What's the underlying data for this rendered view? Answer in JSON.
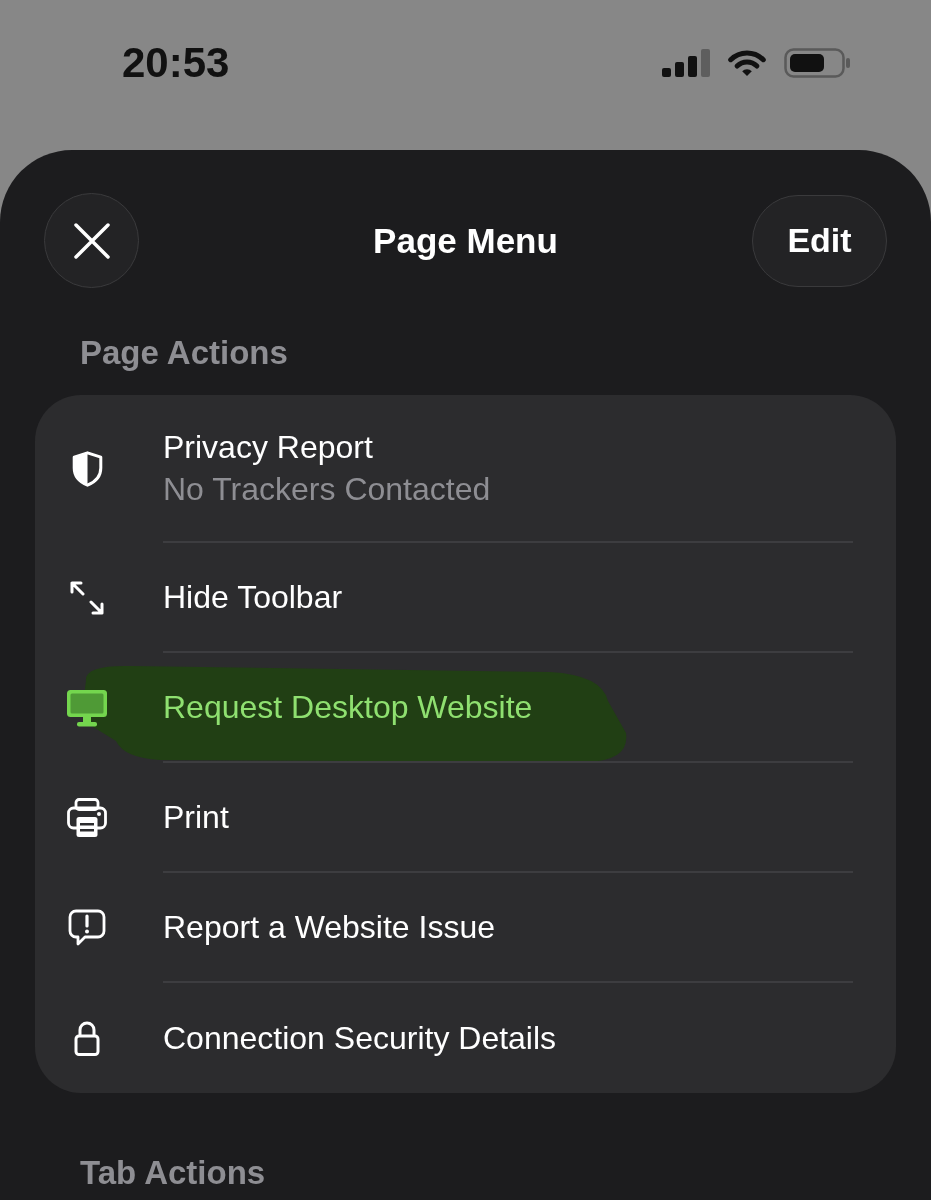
{
  "status_bar": {
    "time": "20:53"
  },
  "sheet": {
    "title": "Page Menu",
    "edit_button": "Edit"
  },
  "sections": [
    {
      "heading": "Page Actions",
      "items": [
        {
          "label": "Privacy Report",
          "detail": "No Trackers Contacted",
          "highlighted": false
        },
        {
          "label": "Hide Toolbar",
          "highlighted": false
        },
        {
          "label": "Request Desktop Website",
          "highlighted": true
        },
        {
          "label": "Print",
          "highlighted": false
        },
        {
          "label": "Report a Website Issue",
          "highlighted": false
        },
        {
          "label": "Connection Security Details",
          "highlighted": false
        }
      ]
    },
    {
      "heading": "Tab Actions"
    }
  ]
}
